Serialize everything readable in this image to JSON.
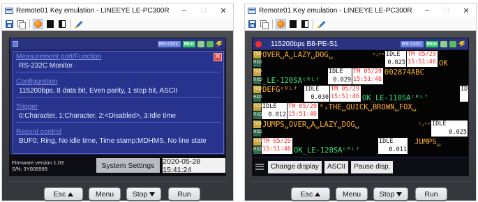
{
  "left_window": {
    "title": "Remote01 Key emulation - LINEEYE LE-PC300R",
    "controls": {
      "minimize": "–",
      "maximize": "□",
      "close": "✕"
    },
    "screen": {
      "header_badges": {
        "interface": "RS-232C",
        "mode": "Mon"
      },
      "menu": [
        {
          "heading": "Measurement port/Function",
          "value": "RS-232C Monitor"
        },
        {
          "heading": "Configuration",
          "value": "115200bps, 8 data bit, Even parity, 1 stop bit, ASCII"
        },
        {
          "heading": "Trigger",
          "value": "0:Character, 1:Character, 2:<Disabled>, 3:Idle time"
        },
        {
          "heading": "Record control",
          "value": "BUF0, Ring, No idle time, Time stamp:MDHMS, No line state"
        }
      ],
      "close_glyph": "✕",
      "firmware_line1": "Firmware version 1.03",
      "firmware_line2": "S/N: 3Y809999",
      "system_settings_button": "System Settings",
      "datetime": "2020-05-28 15:41:24"
    },
    "hardware_buttons": {
      "esc": "Esc",
      "menu": "Menu",
      "stop": "Stop",
      "run": "Run"
    }
  },
  "right_window": {
    "title": "Remote01 Key emulation - LINEEYE LE-PC300R",
    "controls": {
      "minimize": "–",
      "maximize": "□",
      "close": "✕"
    },
    "screen": {
      "header_title": "115200bps B8-PE-S1",
      "header_badges": {
        "interface": "RS-232C",
        "mode": "Mon"
      },
      "line_tags": {
        "txd": "TXD",
        "rxd": "RXD"
      },
      "rows": {
        "r1_top": "OVER␣A␣LAZY␣DOG␣",
        "r1_ctl": "ᴱₓᴿᴮ",
        "r1_idle_label": "IDLE",
        "r1_idle_value": "0.025",
        "r1_ts1": "TM 05/29",
        "r1_ts2": "15:51:46",
        "r1_tail": "OK",
        "r2_bot": "_LE-120SAᶜᴿᴸᶠ",
        "r2_idle_label": "IDLE",
        "r2_idle_value": "0.029",
        "r2_ts1": "TM 05/29",
        "r2_ts2": "15:51:46",
        "r2_tail": "002874ABC",
        "r3_top": "DEFGᶜᴿᴸᶠ",
        "r3_idle_label": "IDLE",
        "r3_idle_value": "0.030",
        "r3_ts1": "TM 05/29",
        "r3_ts2": "15:51:46",
        "r3_tail": "OK_LE-110SAᶜᴿᴸᶠ",
        "r3_end": "ID",
        "r4_idle_label": "IDLE",
        "r4_idle_value": "0.012",
        "r4_ts1": "TM 05/29",
        "r4_ts2": "15:51:46",
        "r4_top": "ᴱₓTHE␣QUICK␣BROWN␣FOX␣",
        "r5_top": "JUMPS␣OVER␣A␣LAZY␣DOG␣",
        "r5_ctl": "ᴱₓᴿᴮ",
        "r5_idle_label": "IDLE",
        "r5_idle_value": "0.025",
        "r6_ts1": "TM 05/29",
        "r6_ts2": "15:51:46",
        "r6_bot": "OK_LE-120SAᶜᴿᴸᶠ",
        "r6_idle_label": "IDLE",
        "r6_idle_value": "0.011",
        "r6_tail": "JUMPS␣"
      },
      "function_buttons": {
        "change_display": "Change display",
        "ascii": "ASCII",
        "pause": "Pause disp."
      }
    },
    "hardware_buttons": {
      "esc": "Esc",
      "menu": "Menu",
      "stop": "Stop",
      "run": "Run"
    }
  },
  "colors": {
    "screen_bg": "#1f2660",
    "txd_text": "#ffae2b",
    "rxd_text": "#36e07a",
    "timestamp": "#ff2a2a",
    "mon_badge": "#2fc86a",
    "record_dot": "#ff2b2b"
  }
}
